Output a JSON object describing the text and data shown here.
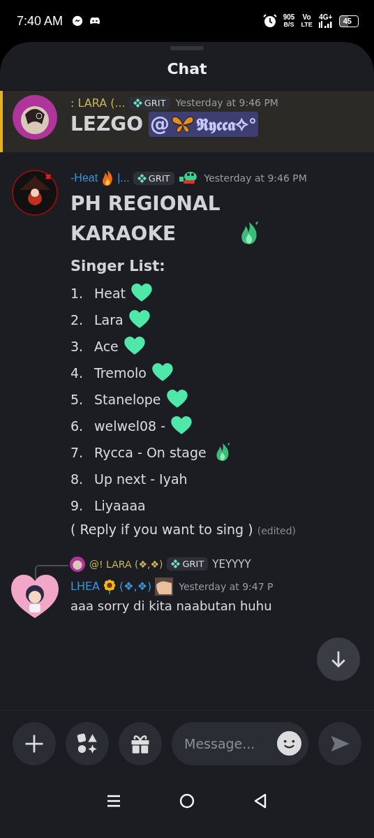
{
  "status_bar": {
    "time": "7:40 AM",
    "speed": "905",
    "speed_unit": "B/S",
    "volte_top": "Vo",
    "volte_bottom": "LTE",
    "network": "4G+",
    "battery": "45"
  },
  "header": {
    "title": "Chat"
  },
  "messages": [
    {
      "kind": "mention",
      "author": ": LARA (...",
      "color": "#c9b458",
      "role": "GRIT",
      "time": "Yesterday at 9:46 PM",
      "text": "LEZGO",
      "mention_at": "@",
      "mention_name": "𝕽𝖞𝖈𝖈𝖆✧°"
    },
    {
      "kind": "list",
      "author": "-Heat",
      "author_suffix": "|...",
      "color": "#3a95d8",
      "role": "GRIT",
      "time": "Yesterday at 9:46 PM",
      "title": "PH REGIONAL KARAOKE",
      "subtitle": "Singer List:",
      "items": [
        {
          "number": "1.",
          "text": "Heat",
          "kind": "heart"
        },
        {
          "number": "2.",
          "text": "Lara",
          "kind": "heart"
        },
        {
          "number": "3.",
          "text": "Ace",
          "kind": "heart"
        },
        {
          "number": "4.",
          "text": "Tremolo",
          "kind": "heart"
        },
        {
          "number": "5.",
          "text": "Stanelope",
          "kind": "heart"
        },
        {
          "number": "6.",
          "text": "welwel08 -",
          "kind": "heart"
        },
        {
          "number": "7.",
          "text": "Rycca - On stage",
          "kind": "flame"
        },
        {
          "number": "8.",
          "text": "Up next - Iyah",
          "kind": "plain"
        },
        {
          "number": "9.",
          "text": "Liyaaaa",
          "kind": "plain"
        }
      ],
      "footer": "( Reply if you want to sing )",
      "edited": "(edited)"
    },
    {
      "kind": "reply",
      "reply": {
        "author": "@! LARA (❖,❖)",
        "color": "#c9b458",
        "role": "GRIT",
        "text": "YEYYYY"
      },
      "author": "LHEA",
      "author_suffix": "(❖,❖)",
      "color": "#3a95d8",
      "time": "Yesterday at 9:47 P",
      "text": "aaa sorry di kita naabutan huhu"
    }
  ],
  "composer": {
    "placeholder": "Message..."
  }
}
